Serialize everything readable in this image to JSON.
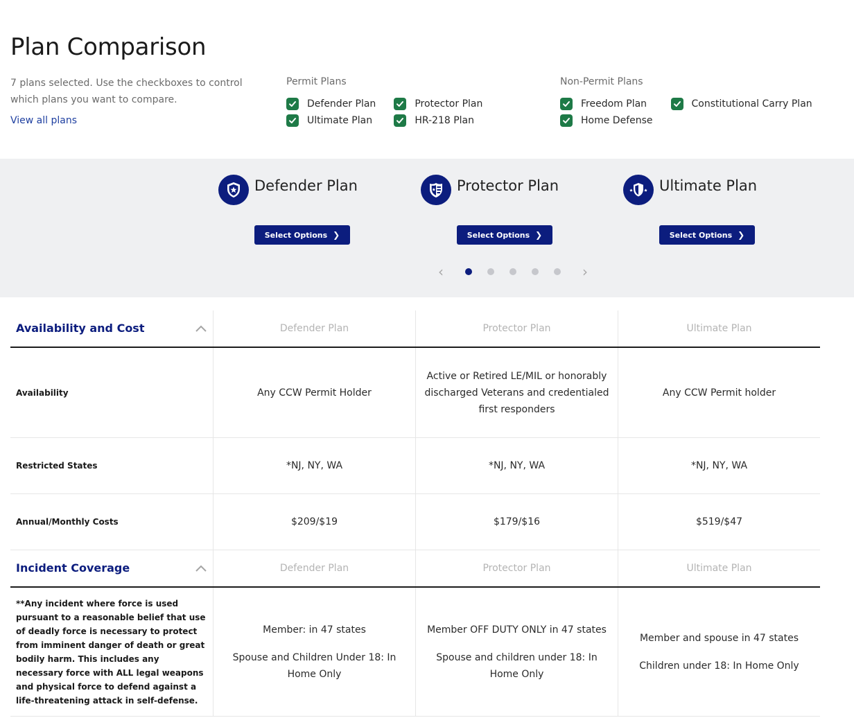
{
  "header": {
    "title": "Plan Comparison",
    "intro": "7 plans selected. Use the checkboxes to control which plans you want to compare.",
    "view_all": "View all plans"
  },
  "filters": {
    "permit": {
      "title": "Permit Plans",
      "options": [
        "Defender Plan",
        "Protector Plan",
        "Ultimate Plan",
        "HR-218 Plan"
      ]
    },
    "nonpermit": {
      "title": "Non-Permit Plans",
      "options": [
        "Freedom Plan",
        "Constitutional Carry Plan",
        "Home Defense"
      ]
    }
  },
  "plans": [
    {
      "name": "Defender Plan",
      "button": "Select Options",
      "icon": "shield-star-icon"
    },
    {
      "name": "Protector Plan",
      "button": "Select Options",
      "icon": "police-shield-icon"
    },
    {
      "name": "Ultimate Plan",
      "button": "Select Options",
      "icon": "star-shield-icon"
    }
  ],
  "pager": {
    "left": "‹",
    "right": "›",
    "pages": 5,
    "active": 1
  },
  "sections": {
    "availability": {
      "title": "Availability and Cost",
      "columns": [
        "Defender Plan",
        "Protector Plan",
        "Ultimate Plan"
      ],
      "rows": [
        {
          "label": "Availability",
          "values": [
            "Any CCW Permit Holder",
            "Active or Retired LE/MIL or honorably discharged Veterans and credentialed first responders",
            "Any CCW Permit holder"
          ]
        },
        {
          "label": "Restricted States",
          "values": [
            "*NJ, NY, WA",
            "*NJ, NY, WA",
            "*NJ, NY, WA"
          ]
        },
        {
          "label": "Annual/Monthly Costs",
          "values": [
            "$209/$19",
            "$179/$16",
            "$519/$47"
          ]
        }
      ]
    },
    "incident": {
      "title": "Incident Coverage",
      "columns": [
        "Defender Plan",
        "Protector Plan",
        "Ultimate Plan"
      ],
      "row": {
        "label": "**Any incident where force is used pursuant to a reasonable belief that use of deadly force is necessary to protect from imminent danger of death or great bodily harm. This includes any necessary force with ALL legal weapons and physical force to defend against a life-threatening attack in self-defense.",
        "values": [
          [
            "Member: in 47 states",
            "Spouse and Children Under 18: In Home Only"
          ],
          [
            "Member OFF DUTY ONLY in 47 states",
            "Spouse and children under 18: In Home Only"
          ],
          [
            "Member and spouse in 47 states",
            "Children under 18: In Home Only"
          ]
        ]
      }
    }
  },
  "colors": {
    "brand": "#0c1d7e",
    "check": "#1e7a47",
    "band": "#eff0f2",
    "link": "#1e3fa0"
  }
}
